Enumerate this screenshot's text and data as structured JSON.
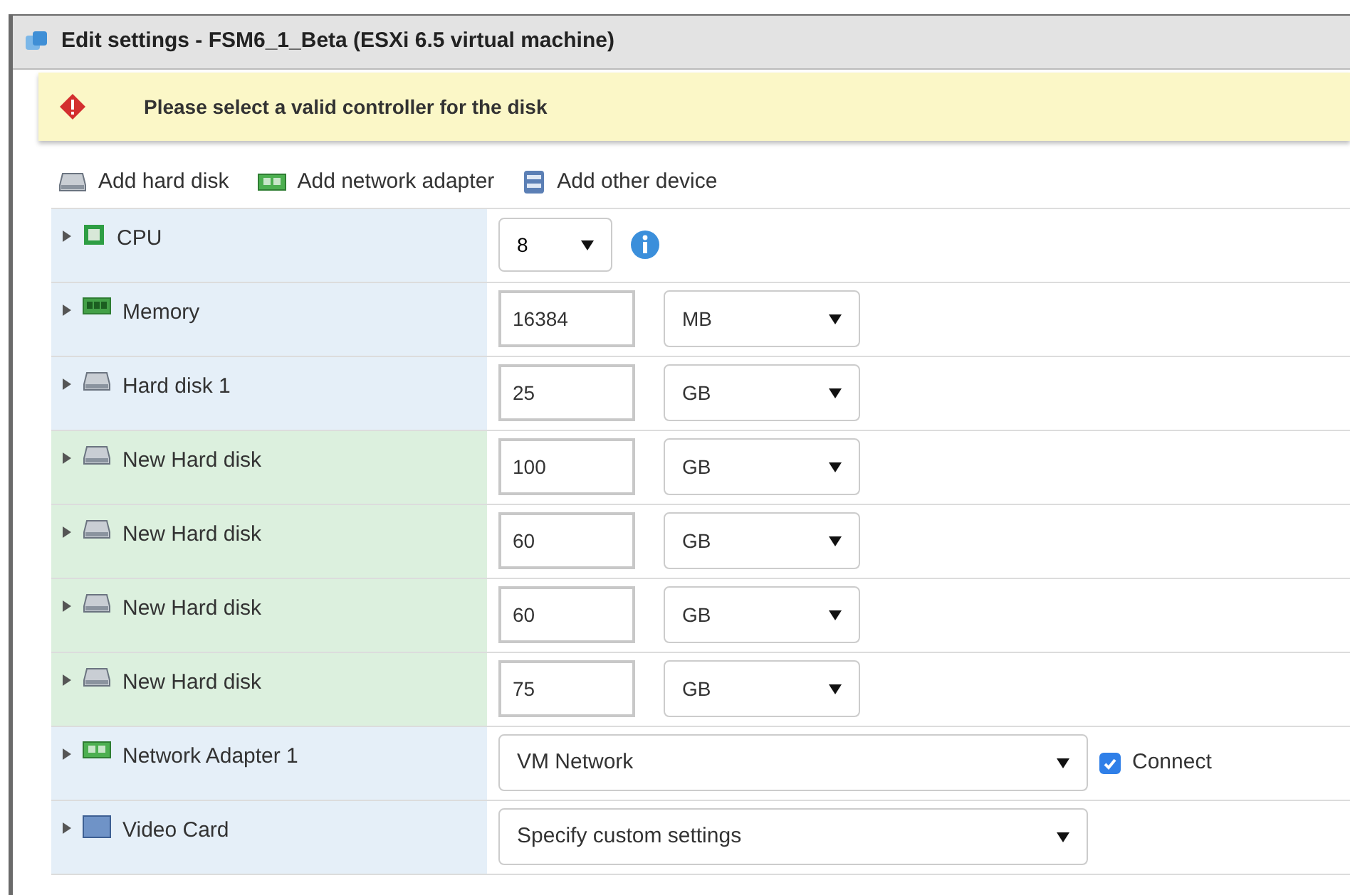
{
  "window": {
    "title": "Edit settings - FSM6_1_Beta (ESXi 6.5 virtual machine)"
  },
  "alert": {
    "message": "Please select a valid controller for the disk"
  },
  "toolbar": [
    {
      "label": "Add hard disk",
      "kind": "disk"
    },
    {
      "label": "Add network adapter",
      "kind": "network"
    },
    {
      "label": "Add other device",
      "kind": "device"
    }
  ],
  "rows": [
    {
      "label": "CPU",
      "kind": "cpu",
      "new": false,
      "value": "8"
    },
    {
      "label": "Memory",
      "kind": "memory",
      "new": false,
      "value": "16384",
      "unit": "MB"
    },
    {
      "label": "Hard disk 1",
      "kind": "disk",
      "new": false,
      "value": "25",
      "unit": "GB"
    },
    {
      "label": "New Hard disk",
      "kind": "disk",
      "new": true,
      "value": "100",
      "unit": "GB"
    },
    {
      "label": "New Hard disk",
      "kind": "disk",
      "new": true,
      "value": "60",
      "unit": "GB"
    },
    {
      "label": "New Hard disk",
      "kind": "disk",
      "new": true,
      "value": "60",
      "unit": "GB"
    },
    {
      "label": "New Hard disk",
      "kind": "disk",
      "new": true,
      "value": "75",
      "unit": "GB"
    },
    {
      "label": "Network Adapter 1",
      "kind": "network",
      "new": false,
      "value": "VM Network",
      "connect": {
        "label": "Connect",
        "checked": true
      }
    },
    {
      "label": "Video Card",
      "kind": "video",
      "new": false,
      "value": "Specify custom settings"
    }
  ]
}
